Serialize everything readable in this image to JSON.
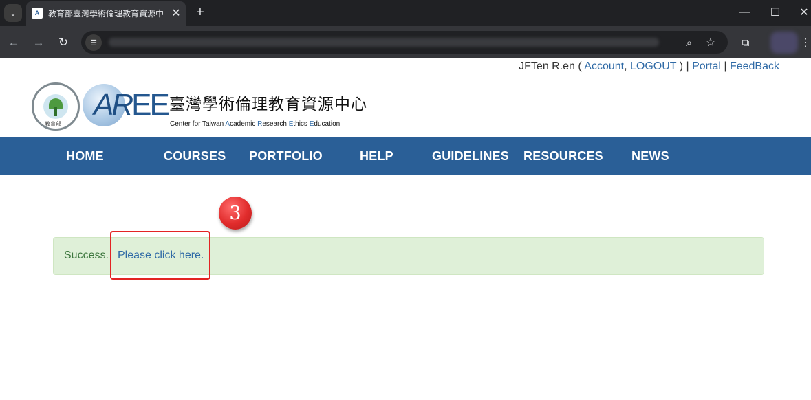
{
  "browser": {
    "tab_title": "教育部臺灣學術倫理教育資源中心",
    "favicon_text": "A",
    "tab_close": "✕",
    "new_tab": "+",
    "window": {
      "minimize": "—",
      "maximize": "☐",
      "close": "✕"
    },
    "nav": {
      "back": "←",
      "forward": "→",
      "reload": "↻"
    },
    "omnibox_icon": "☰",
    "zoom_icon": "⌕",
    "star_icon": "☆",
    "extensions_icon": "⧉",
    "menu_icon": "⋮",
    "tab_menu_icon": "⌄"
  },
  "user_bar": {
    "username": "JFTen R.en",
    "open_paren": " ( ",
    "account": "Account",
    "comma": ", ",
    "logout": "LOGOUT",
    "close_sep": " ) | ",
    "portal": "Portal",
    "sep": " | ",
    "feedback": "FeedBack"
  },
  "logo": {
    "seal_text": "教育部",
    "mark_a": "A",
    "mark_r": "R",
    "mark_ee": "EE",
    "cn_name": "臺灣學術倫理教育資源中心",
    "en_prefix": "Center for Taiwan ",
    "en_a": "A",
    "en_cademic": "cademic ",
    "en_r": "R",
    "en_esearch": "esearch ",
    "en_e1": "E",
    "en_thics": "thics ",
    "en_e2": "E",
    "en_ducation": "ducation"
  },
  "navbar": {
    "items": [
      "HOME",
      "COURSES",
      "PORTFOLIO",
      "HELP",
      "GUIDELINES",
      "RESOURCES",
      "NEWS"
    ]
  },
  "step_marker": "3",
  "alert": {
    "message": "Success.",
    "link": "Please click here."
  },
  "colors": {
    "navbar": "#2a5f97",
    "link": "#2f6aa6",
    "alert_bg": "#dff0d8",
    "alert_text": "#3c763d",
    "highlight": "#e32424"
  }
}
